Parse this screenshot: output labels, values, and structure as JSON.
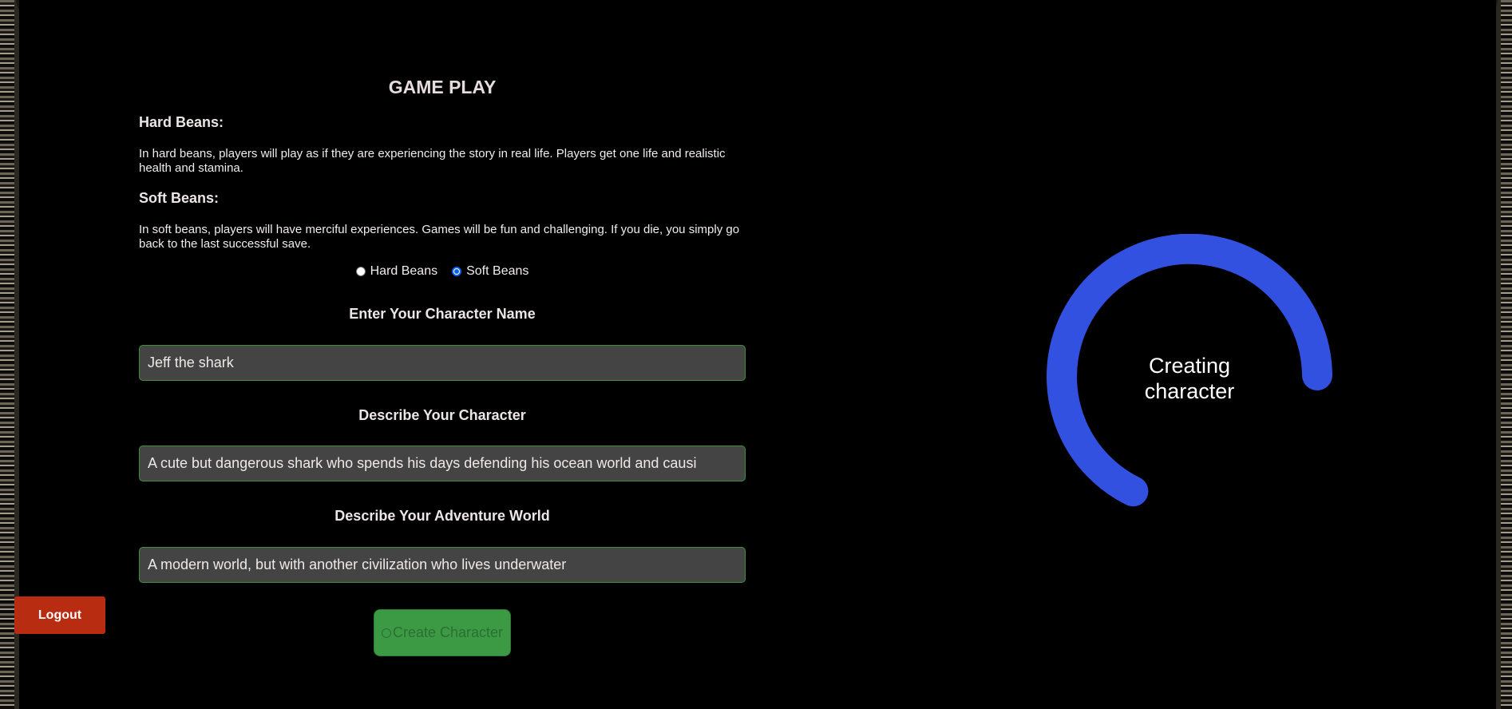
{
  "game_play": {
    "title": "GAME PLAY",
    "hard_heading": "Hard Beans:",
    "hard_text": "In hard beans, players will play as if they are experiencing the story in real life. Players get one life and realistic health and stamina.",
    "soft_heading": "Soft Beans:",
    "soft_text": "In soft beans, players will have merciful experiences. Games will be fun and challenging. If you die, you simply go back to the last successful save.",
    "radio_hard": "Hard Beans",
    "radio_soft": "Soft Beans",
    "selected_mode": "Soft Beans"
  },
  "character": {
    "name_label": "Enter Your Character Name",
    "name_value": "Jeff the shark",
    "desc_label": "Describe Your Character",
    "desc_value": "A cute but dangerous shark who spends his days defending his ocean world and causi",
    "world_label": "Describe Your Adventure World",
    "world_value": "A modern world, but with another civilization who lives underwater"
  },
  "buttons": {
    "create": "Create Character",
    "logout": "Logout"
  },
  "loader": {
    "line1": "Creating",
    "line2": "character",
    "color": "#3351e0"
  },
  "colors": {
    "background": "#000000",
    "input_border": "#3f8f3f",
    "create_button": "#3c9a45",
    "logout_button": "#b82c12"
  }
}
